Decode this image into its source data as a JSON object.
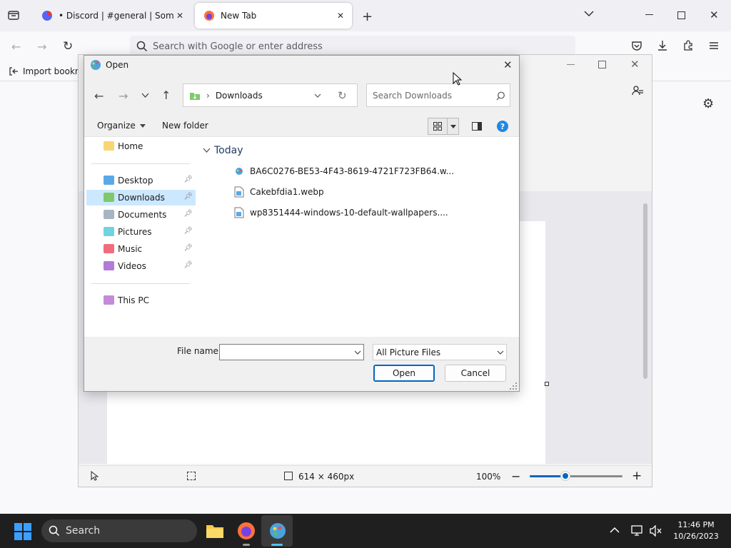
{
  "browser": {
    "tabs": [
      {
        "title": "• Discord | #general | SomeBot's"
      },
      {
        "title": "New Tab"
      }
    ],
    "urlbar_placeholder": "Search with Google or enter address",
    "bookmarks_import": "Import bookm"
  },
  "paint": {
    "status_size": "614 × 460px",
    "zoom": "100%"
  },
  "dialog": {
    "title": "Open",
    "address_path": "Downloads",
    "search_placeholder": "Search Downloads",
    "organize_label": "Organize",
    "new_folder_label": "New folder",
    "nav_home": "Home",
    "nav_pinned": [
      {
        "label": "Desktop"
      },
      {
        "label": "Downloads"
      },
      {
        "label": "Documents"
      },
      {
        "label": "Pictures"
      },
      {
        "label": "Music"
      },
      {
        "label": "Videos"
      }
    ],
    "nav_this_pc": "This PC",
    "group_label": "Today",
    "files": [
      {
        "name": "BA6C0276-BE53-4F43-8619-4721F723FB64.w..."
      },
      {
        "name": "Cakebfdia1.webp"
      },
      {
        "name": "wp8351444-windows-10-default-wallpapers...."
      }
    ],
    "file_name_label": "File name:",
    "file_name_value": "",
    "file_type_selected": "All Picture Files",
    "open_button": "Open",
    "cancel_button": "Cancel"
  },
  "taskbar": {
    "search_label": "Search",
    "time": "11:46 PM",
    "date": "10/26/2023"
  },
  "colors": {
    "accent": "#0067c0",
    "selection": "#cce8ff",
    "taskbar": "#1f1f1f"
  }
}
